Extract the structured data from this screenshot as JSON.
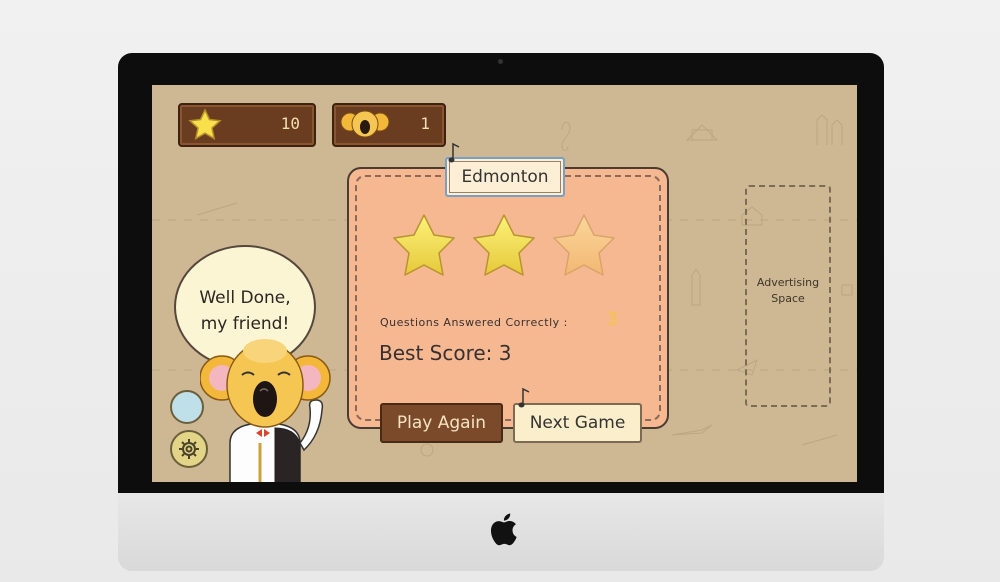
{
  "hud": {
    "stars_icon": "star-icon",
    "stars_value": "10",
    "koala_icon": "koala-face-icon",
    "koala_value": "1"
  },
  "result": {
    "city": "Edmonton",
    "stars_earned": 2,
    "stars_total": 3,
    "questions_label": "Questions Answered Correctly :",
    "questions_value": "3",
    "best_score_label": "Best Score: 3"
  },
  "buttons": {
    "play_again": "Play Again",
    "next_game": "Next Game"
  },
  "ad": {
    "line1": "Advertising",
    "line2": "Space"
  },
  "speech": {
    "line1": "Well Done,",
    "line2": "my friend!"
  },
  "colors": {
    "background": "#cdb893",
    "card": "#f6b891",
    "star": "#f7e04c",
    "star_dim": "#f8c88a",
    "panel": "#6b3d20"
  }
}
